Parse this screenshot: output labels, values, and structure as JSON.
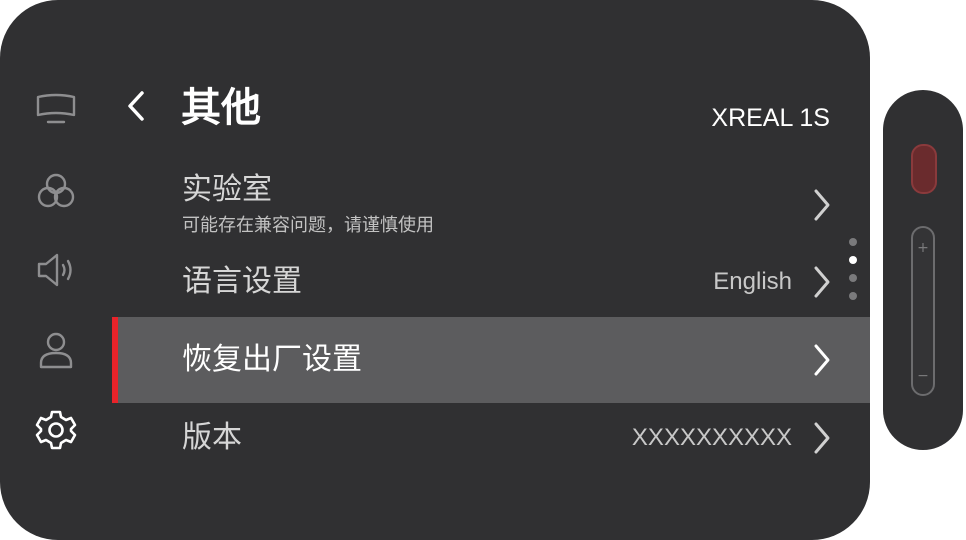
{
  "header": {
    "title": "其他",
    "device_name": "XREAL 1S"
  },
  "sidebar": {
    "items": [
      {
        "icon": "display-icon"
      },
      {
        "icon": "color-circles-icon"
      },
      {
        "icon": "speaker-icon"
      },
      {
        "icon": "user-icon"
      },
      {
        "icon": "gear-icon",
        "active": true
      }
    ]
  },
  "menu": {
    "items": [
      {
        "label": "实验室",
        "subtitle": "可能存在兼容问题，请谨慎使用",
        "value": ""
      },
      {
        "label": "语言设置",
        "value": "English"
      },
      {
        "label": "恢复出厂设置",
        "value": "",
        "selected": true
      },
      {
        "label": "版本",
        "value": "XXXXXXXXXX"
      }
    ]
  },
  "pagination": {
    "count": 4,
    "current": 2
  },
  "remote": {
    "volume_plus": "+",
    "volume_minus": "−"
  },
  "colors": {
    "panel": "#303032",
    "selected_row": "#5c5c5e",
    "accent": "#e8232a",
    "remote_button": "#6a2b2d"
  }
}
